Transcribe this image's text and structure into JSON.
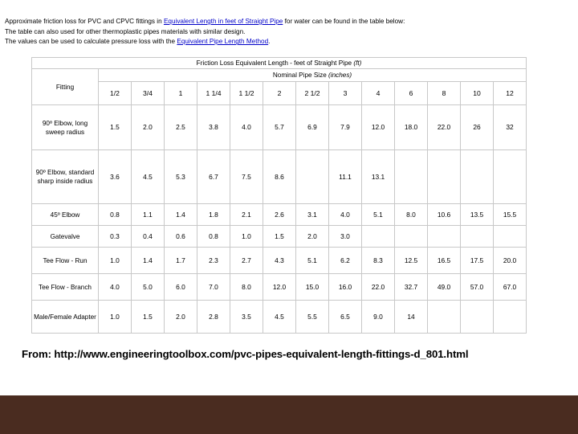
{
  "slide": {
    "background_color": "#ffffff",
    "footer_bar_color": "#4a2c20"
  },
  "intro": {
    "line1_before": "Approximate friction loss for PVC and CPVC fittings in ",
    "line1_link": "Equivalent Length in feet of Straight Pipe",
    "line1_after": " for water can be found in the table below:",
    "line2": "The table can also used for other thermoplastic pipes materials with similar design.",
    "line3_before": "The values can be used to calculate pressure loss with the ",
    "line3_link": "Equivalent Pipe Length Method",
    "line3_after": ".",
    "link_color": "#0000c8"
  },
  "table": {
    "band_title_main": "Friction Loss Equivalent Length - feet of Straight Pipe ",
    "band_title_unit": "(ft)",
    "band_sub_main": "Nominal Pipe Size ",
    "band_sub_unit": "(inches)",
    "fitting_header": "Fitting",
    "sizes": [
      "1/2",
      "3/4",
      "1",
      "1 1/4",
      "1 1/2",
      "2",
      "2 1/2",
      "3",
      "4",
      "6",
      "8",
      "10",
      "12"
    ],
    "rows": [
      {
        "fitting": "90º Elbow, long sweep radius",
        "values": [
          "1.5",
          "2.0",
          "2.5",
          "3.8",
          "4.0",
          "5.7",
          "6.9",
          "7.9",
          "12.0",
          "18.0",
          "22.0",
          "26",
          "32"
        ]
      },
      {
        "fitting": "90º Elbow, standard sharp inside radius",
        "values": [
          "3.6",
          "4.5",
          "5.3",
          "6.7",
          "7.5",
          "8.6",
          "",
          "11.1",
          "13.1",
          "",
          "",
          "",
          ""
        ]
      },
      {
        "fitting": "45º Elbow",
        "values": [
          "0.8",
          "1.1",
          "1.4",
          "1.8",
          "2.1",
          "2.6",
          "3.1",
          "4.0",
          "5.1",
          "8.0",
          "10.6",
          "13.5",
          "15.5"
        ]
      },
      {
        "fitting": "Gatevalve",
        "values": [
          "0.3",
          "0.4",
          "0.6",
          "0.8",
          "1.0",
          "1.5",
          "2.0",
          "3.0",
          "",
          "",
          "",
          "",
          ""
        ]
      },
      {
        "fitting": "Tee Flow - Run",
        "values": [
          "1.0",
          "1.4",
          "1.7",
          "2.3",
          "2.7",
          "4.3",
          "5.1",
          "6.2",
          "8.3",
          "12.5",
          "16.5",
          "17.5",
          "20.0"
        ]
      },
      {
        "fitting": "Tee Flow - Branch",
        "values": [
          "4.0",
          "5.0",
          "6.0",
          "7.0",
          "8.0",
          "12.0",
          "15.0",
          "16.0",
          "22.0",
          "32.7",
          "49.0",
          "57.0",
          "67.0"
        ]
      },
      {
        "fitting": "Male/Female Adapter",
        "values": [
          "1.0",
          "1.5",
          "2.0",
          "2.8",
          "3.5",
          "4.5",
          "5.5",
          "6.5",
          "9.0",
          "14",
          "",
          "",
          ""
        ]
      }
    ]
  },
  "source": {
    "text": "From: http://www.engineeringtoolbox.com/pvc-pipes-equivalent-length-fittings-d_801.html"
  }
}
